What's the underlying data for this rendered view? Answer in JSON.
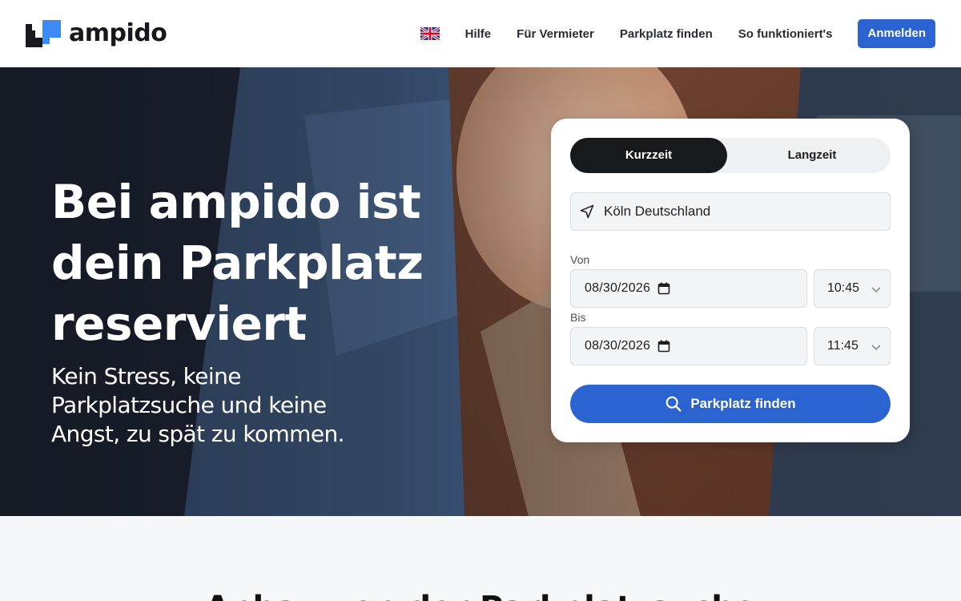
{
  "brand": {
    "name": "ampido",
    "color_primary": "#2b63d1",
    "color_dark": "#17191d",
    "color_light_blue": "#3d8af7"
  },
  "header": {
    "language_icon": "uk-flag-icon",
    "nav": [
      {
        "label": "Hilfe"
      },
      {
        "label": "Für Vermieter"
      },
      {
        "label": "Parkplatz finden"
      },
      {
        "label": "So funktioniert's"
      }
    ],
    "login_label": "Anmelden"
  },
  "hero": {
    "title_lines": [
      "Bei ampido ist",
      "dein Parkplatz",
      "reserviert"
    ],
    "subtitle_lines": [
      "Kein Stress, keine",
      "Parkplatzsuche und keine",
      "Angst, zu spät zu kommen."
    ]
  },
  "search": {
    "tabs": [
      {
        "label": "Kurzzeit",
        "active": true
      },
      {
        "label": "Langzeit",
        "active": false
      }
    ],
    "location": {
      "value": "Köln Deutschland",
      "icon": "navigation-arrow-icon"
    },
    "from": {
      "label": "Von",
      "date": "08/30/2026",
      "time": "10:45"
    },
    "to": {
      "label": "Bis",
      "date": "08/30/2026",
      "time": "11:45"
    },
    "submit_label": "Parkplatz finden",
    "submit_icon": "search-icon"
  },
  "section": {
    "title": "Anbau von der Parkplatzsuche"
  }
}
